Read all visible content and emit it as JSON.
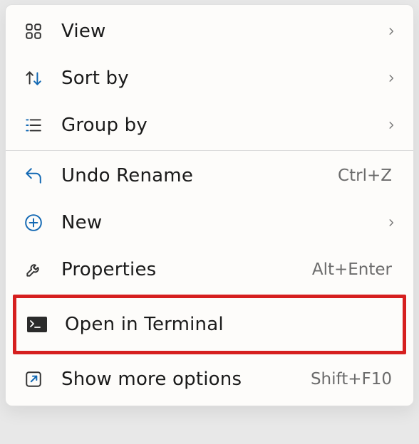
{
  "menu": {
    "view": {
      "label": "View",
      "has_submenu": true
    },
    "sort_by": {
      "label": "Sort by",
      "has_submenu": true
    },
    "group_by": {
      "label": "Group by",
      "has_submenu": true
    },
    "undo_rename": {
      "label": "Undo Rename",
      "shortcut": "Ctrl+Z"
    },
    "new": {
      "label": "New",
      "has_submenu": true
    },
    "properties": {
      "label": "Properties",
      "shortcut": "Alt+Enter"
    },
    "open_terminal": {
      "label": "Open in Terminal"
    },
    "show_more": {
      "label": "Show more options",
      "shortcut": "Shift+F10"
    }
  },
  "colors": {
    "icon_blue": "#1268b3",
    "icon_dark": "#333333",
    "chevron": "#777777",
    "highlight": "#d61f1f"
  }
}
